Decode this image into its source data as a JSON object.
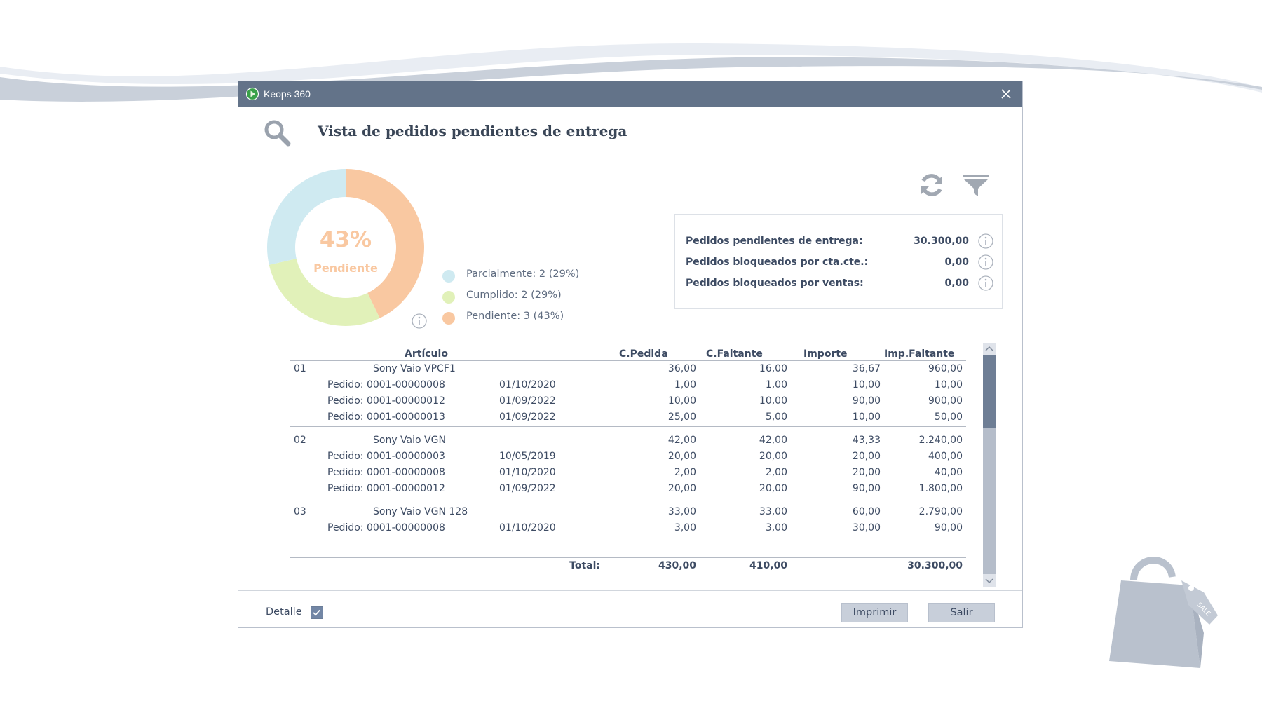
{
  "window": {
    "title": "Keops 360"
  },
  "page": {
    "title": "Vista de pedidos pendientes de entrega"
  },
  "chart_data": {
    "type": "pie",
    "center_value": "43%",
    "center_label": "Pendiente",
    "slices": [
      {
        "name": "Parcialmente",
        "legend": "Parcialmente: 2 (29%)",
        "count": 2,
        "percent": 29,
        "color": "#cfeaf1"
      },
      {
        "name": "Cumplido",
        "legend": "Cumplido: 2 (29%)",
        "count": 2,
        "percent": 29,
        "color": "#e1f1b9"
      },
      {
        "name": "Pendiente",
        "legend": "Pendiente: 3 (43%)",
        "count": 3,
        "percent": 43,
        "color": "#f9c8a1"
      }
    ]
  },
  "summary": [
    {
      "label": "Pedidos pendientes de entrega:",
      "value": "30.300,00"
    },
    {
      "label": "Pedidos bloqueados por cta.cte.:",
      "value": "0,00"
    },
    {
      "label": "Pedidos bloqueados por ventas:",
      "value": "0,00"
    }
  ],
  "grid": {
    "headers": {
      "articulo": "Artículo",
      "cpedida": "C.Pedida",
      "cfaltante": "C.Faltante",
      "importe": "Importe",
      "impfaltante": "Imp.Faltante"
    },
    "groups": [
      {
        "code": "01",
        "article": "Sony Vaio VPCF1",
        "cpedida": "36,00",
        "cfaltante": "16,00",
        "importe": "36,67",
        "impfaltante": "960,00",
        "orders": [
          {
            "pedido": "Pedido: 0001-00000008",
            "date": "01/10/2020",
            "cpedida": "1,00",
            "cfaltante": "1,00",
            "importe": "10,00",
            "impfaltante": "10,00"
          },
          {
            "pedido": "Pedido: 0001-00000012",
            "date": "01/09/2022",
            "cpedida": "10,00",
            "cfaltante": "10,00",
            "importe": "90,00",
            "impfaltante": "900,00"
          },
          {
            "pedido": "Pedido: 0001-00000013",
            "date": "01/09/2022",
            "cpedida": "25,00",
            "cfaltante": "5,00",
            "importe": "10,00",
            "impfaltante": "50,00"
          }
        ]
      },
      {
        "code": "02",
        "article": "Sony Vaio VGN",
        "cpedida": "42,00",
        "cfaltante": "42,00",
        "importe": "43,33",
        "impfaltante": "2.240,00",
        "orders": [
          {
            "pedido": "Pedido: 0001-00000003",
            "date": "10/05/2019",
            "cpedida": "20,00",
            "cfaltante": "20,00",
            "importe": "20,00",
            "impfaltante": "400,00"
          },
          {
            "pedido": "Pedido: 0001-00000008",
            "date": "01/10/2020",
            "cpedida": "2,00",
            "cfaltante": "2,00",
            "importe": "20,00",
            "impfaltante": "40,00"
          },
          {
            "pedido": "Pedido: 0001-00000012",
            "date": "01/09/2022",
            "cpedida": "20,00",
            "cfaltante": "20,00",
            "importe": "90,00",
            "impfaltante": "1.800,00"
          }
        ]
      },
      {
        "code": "03",
        "article": "Sony Vaio VGN 128",
        "cpedida": "33,00",
        "cfaltante": "33,00",
        "importe": "60,00",
        "impfaltante": "2.790,00",
        "orders": [
          {
            "pedido": "Pedido: 0001-00000008",
            "date": "01/10/2020",
            "cpedida": "3,00",
            "cfaltante": "3,00",
            "importe": "30,00",
            "impfaltante": "90,00"
          }
        ]
      }
    ],
    "total": {
      "label": "Total:",
      "cpedida": "430,00",
      "cfaltante": "410,00",
      "impfaltante": "30.300,00"
    }
  },
  "footer": {
    "detail_label": "Detalle",
    "detail_checked": true,
    "print_label": "Imprimir",
    "exit_label": "Salir"
  },
  "decor": {
    "bag_tag_text": "SALE"
  }
}
